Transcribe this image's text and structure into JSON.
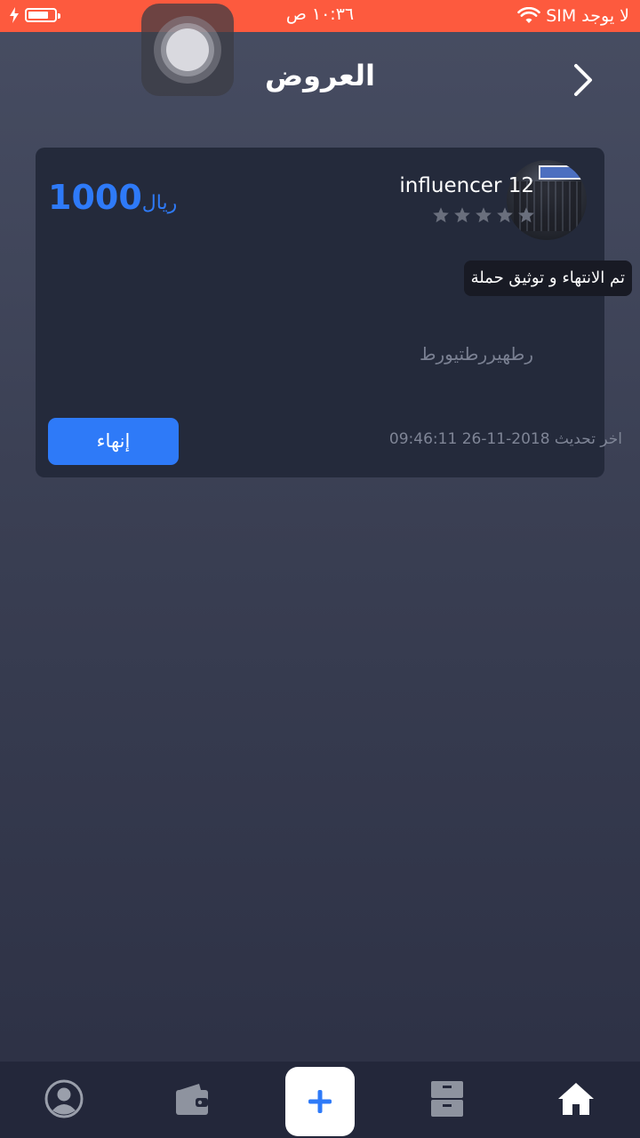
{
  "status_bar": {
    "carrier": "لا يوجد SIM",
    "time": "١٠:٣٦ ص",
    "battery_level": 0.85
  },
  "header": {
    "title": "العروض"
  },
  "offer": {
    "influencer_name": "influencer 12",
    "rating": 0,
    "rating_max": 5,
    "price_amount": "1000",
    "price_currency": "ريال",
    "status": "تم الانتهاء و توثيق حملة",
    "description": "رطهيررطتيورط",
    "last_updated": "اخر تحديث 2018-11-26 09:46:11",
    "finish_label": "إنهاء"
  },
  "tabbar": {
    "items": [
      "profile-icon",
      "wallet-icon",
      "add-icon",
      "archive-icon",
      "home-icon"
    ]
  },
  "colors": {
    "status_bar": "#fd5a3e",
    "accent": "#2e7af8",
    "card": "#242a3b"
  }
}
